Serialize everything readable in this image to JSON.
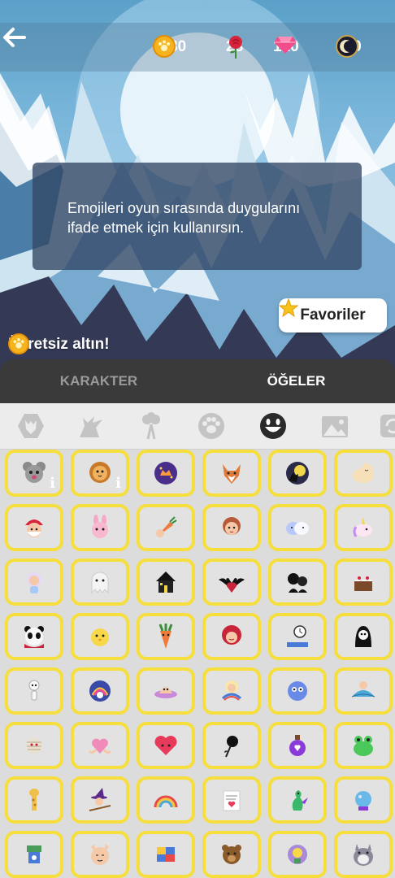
{
  "header": {
    "currencies": [
      {
        "name": "gold",
        "value": "1130",
        "color": "#f5b41e"
      },
      {
        "name": "rose",
        "value": "28",
        "color": "#d8243a"
      },
      {
        "name": "gem",
        "value": "120",
        "color": "#f24d8a"
      },
      {
        "name": "moon",
        "value": "100",
        "color": "#1b1b2e"
      }
    ]
  },
  "info": {
    "line1": "Emojileri oyun sırasında duygularını",
    "line2": "ifade etmek için kullanırsın."
  },
  "favorites_label": "Favoriler",
  "free_gold_label": "Ücretsiz altın!",
  "tabs": [
    {
      "label": "KARAKTER",
      "active": false
    },
    {
      "label": "ÖĞELER",
      "active": true
    }
  ],
  "categories": [
    "wolf-head-icon",
    "wolf-howl-icon",
    "rose-bouquet-icon",
    "paw-icon",
    "smiley-icon",
    "landscape-icon",
    "refresh-icon"
  ],
  "emoji_grid_rows": 8,
  "emoji_grid_cols": 6
}
